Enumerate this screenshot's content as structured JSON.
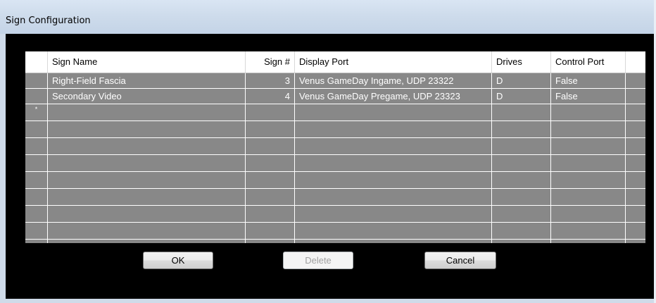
{
  "window": {
    "title": "Sign Configuration"
  },
  "grid": {
    "columns": [
      "Sign Name",
      "Sign #",
      "Display Port",
      "Drives",
      "Control Port"
    ],
    "rows": [
      {
        "sign_name": "Right-Field Fascia",
        "sign_num": "3",
        "display_port": "Venus GameDay Ingame, UDP 23322",
        "drives": "D",
        "control_port": "False"
      },
      {
        "sign_name": "Secondary Video",
        "sign_num": "4",
        "display_port": "Venus GameDay Pregame, UDP 23323",
        "drives": "D",
        "control_port": "False"
      }
    ],
    "new_row_marker": "*"
  },
  "buttons": {
    "ok": "OK",
    "delete": "Delete",
    "cancel": "Cancel"
  }
}
